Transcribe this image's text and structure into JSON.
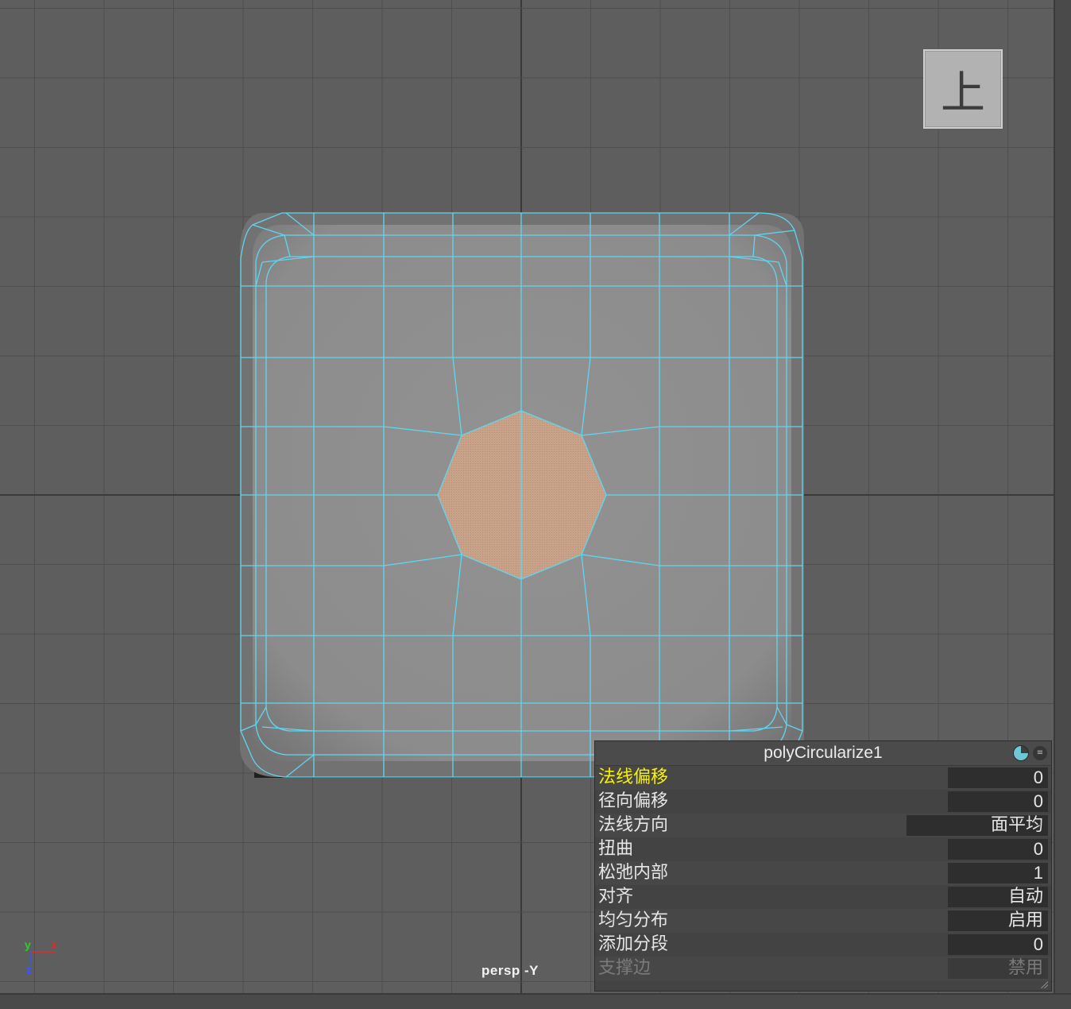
{
  "viewport": {
    "camera_label": "persp -Y",
    "viewcube_face": "上",
    "axes": {
      "y": "y",
      "x": "x",
      "z": "z"
    },
    "colors": {
      "background": "#5e5e5e",
      "grid_line": "#4e4e4e",
      "grid_axis": "#3a3a3a",
      "wireframe": "#5fd6f0",
      "selected_face": "#c8a389",
      "mesh_surface": "#8c8c8c",
      "axis_x": "#e02a2a",
      "axis_y": "#2ad12a",
      "axis_z": "#3a55ff"
    }
  },
  "channel_box": {
    "title": "polyCircularize1",
    "pin_icon": "pin-icon",
    "menu_icon": "menu-icon",
    "rows": [
      {
        "label": "法线偏移",
        "value": "0",
        "state": "highlight"
      },
      {
        "label": "径向偏移",
        "value": "0",
        "state": "normal"
      },
      {
        "label": "法线方向",
        "value": "面平均",
        "state": "normal"
      },
      {
        "label": "扭曲",
        "value": "0",
        "state": "normal"
      },
      {
        "label": "松弛内部",
        "value": "1",
        "state": "normal"
      },
      {
        "label": "对齐",
        "value": "自动",
        "state": "normal"
      },
      {
        "label": "均匀分布",
        "value": "启用",
        "state": "normal"
      },
      {
        "label": "添加分段",
        "value": "0",
        "state": "normal"
      },
      {
        "label": "支撑边",
        "value": "禁用",
        "state": "disabled"
      }
    ]
  }
}
